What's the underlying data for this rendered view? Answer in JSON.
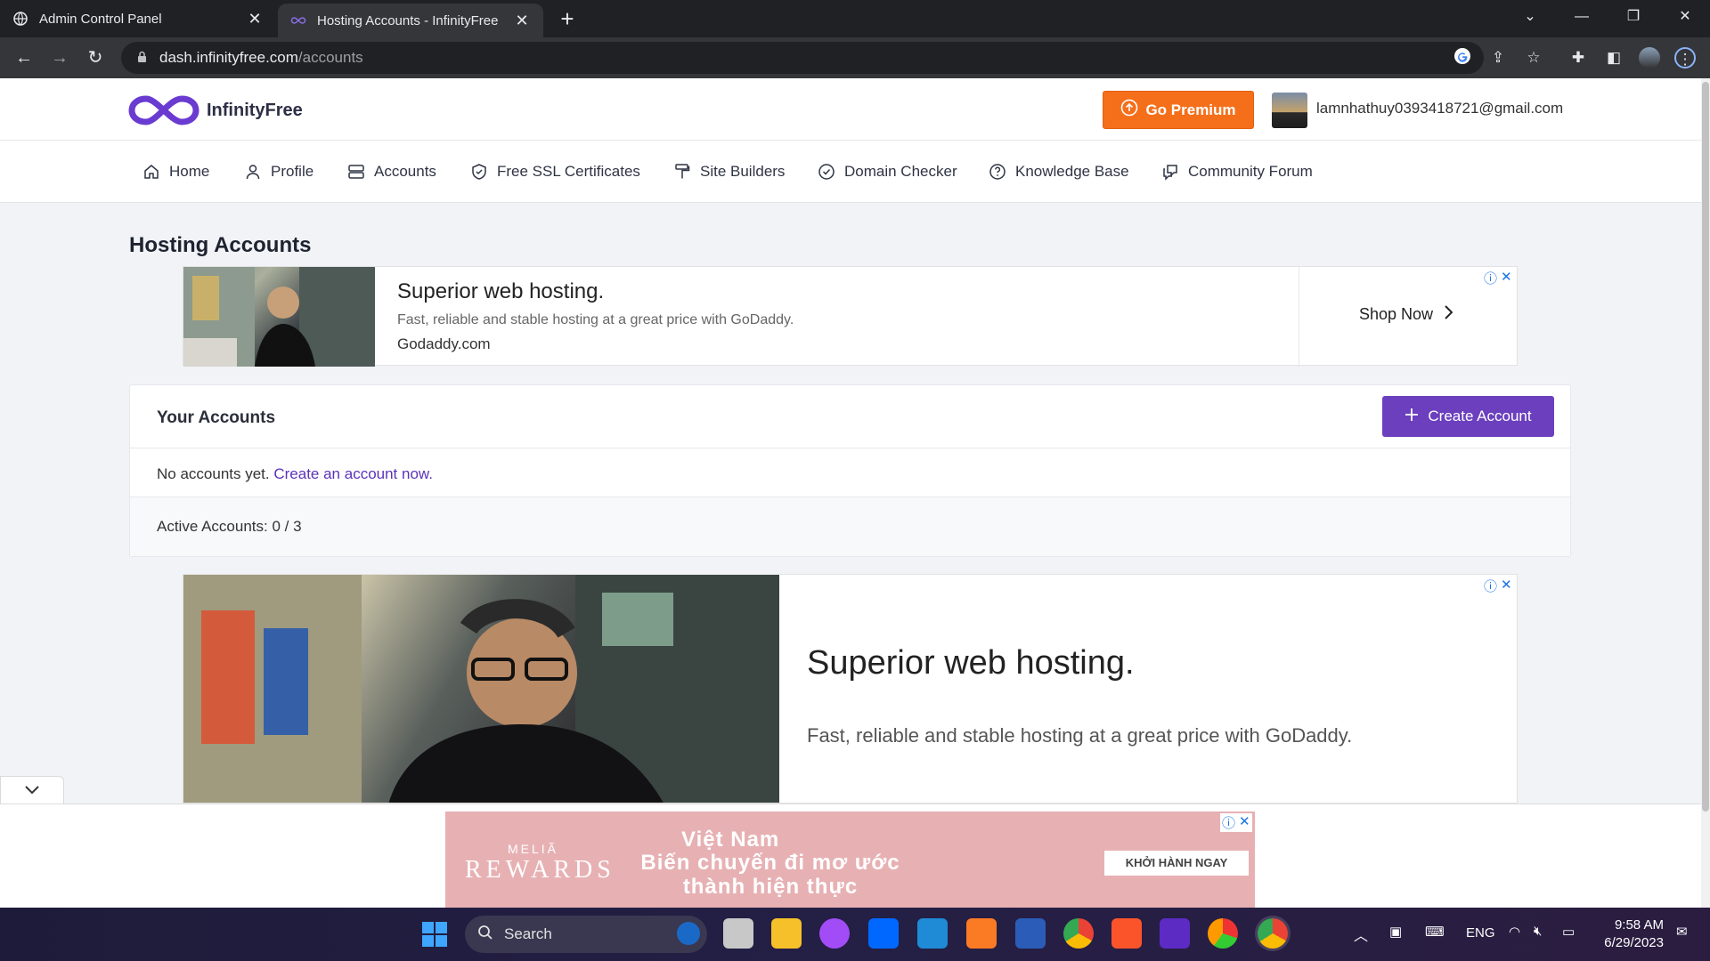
{
  "browser": {
    "tabs": [
      {
        "title": "Admin Control Panel",
        "active": false
      },
      {
        "title": "Hosting Accounts - InfinityFree",
        "active": true
      }
    ],
    "url_host": "dash.infinityfree.com",
    "url_path": "/accounts"
  },
  "header": {
    "brand": "InfinityFree",
    "premium_label": "Go Premium",
    "user_email": "lamnhathuy0393418721@gmail.com"
  },
  "nav": {
    "items": [
      {
        "label": "Home",
        "icon": "home-icon"
      },
      {
        "label": "Profile",
        "icon": "user-icon"
      },
      {
        "label": "Accounts",
        "icon": "server-icon"
      },
      {
        "label": "Free SSL Certificates",
        "icon": "shield-icon"
      },
      {
        "label": "Site Builders",
        "icon": "paint-roller-icon"
      },
      {
        "label": "Domain Checker",
        "icon": "check-circle-icon"
      },
      {
        "label": "Knowledge Base",
        "icon": "help-circle-icon"
      },
      {
        "label": "Community Forum",
        "icon": "forum-icon"
      }
    ]
  },
  "page": {
    "title": "Hosting Accounts"
  },
  "ad1": {
    "headline": "Superior web hosting.",
    "description": "Fast, reliable and stable hosting at a great price with GoDaddy.",
    "domain": "Godaddy.com",
    "cta": "Shop Now"
  },
  "accounts": {
    "title": "Your Accounts",
    "create_label": "Create Account",
    "empty_prefix": "No accounts yet.",
    "empty_link": "Create an account now.",
    "active_label": "Active Accounts: 0 / 3"
  },
  "ad2": {
    "headline": "Superior web hosting.",
    "description": "Fast, reliable and stable hosting at a great price with GoDaddy."
  },
  "bottom_ad": {
    "brand_top": "MELIÃ",
    "brand_main": "REWARDS",
    "headline1": "Việt Nam",
    "headline2": "Biến chuyến đi mơ ước thành hiện thực",
    "cta": "KHỞI HÀNH NGAY"
  },
  "taskbar": {
    "search_label": "Search",
    "language": "ENG",
    "time": "9:58 AM",
    "date": "6/29/2023"
  },
  "colors": {
    "accent_purple": "#6b3fbe",
    "premium_orange": "#f56f1a",
    "link_purple": "#5b33b8"
  }
}
